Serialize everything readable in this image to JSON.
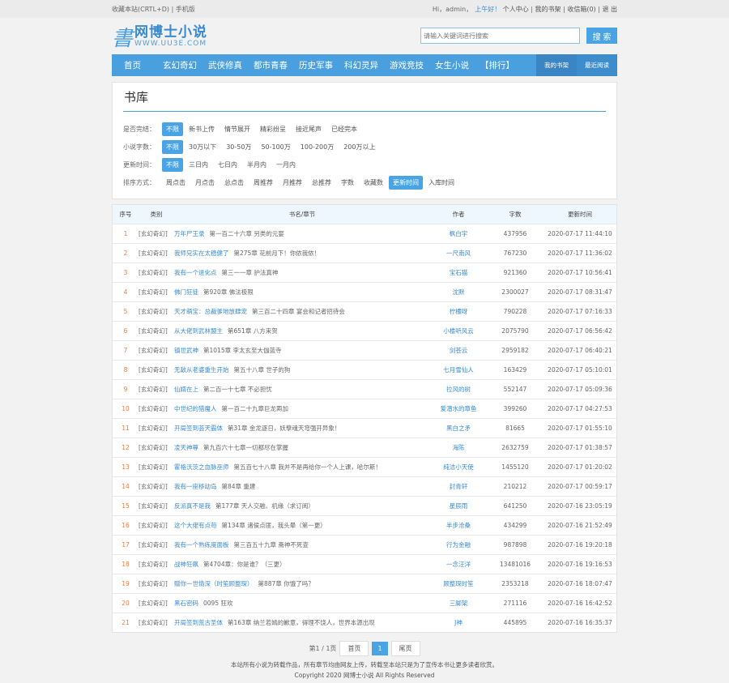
{
  "topbar": {
    "bookmark": "收藏本站(CRTL+D)",
    "sep": "|",
    "mobile": "手机版",
    "greeting": "Hi，admin，",
    "time_greet": "上午好！",
    "user_center": "个人中心",
    "bookshelf": "我的书架",
    "inbox": "收信箱(0)",
    "logout": "退 出"
  },
  "header": {
    "logo_mark": "書",
    "logo_title": "网博士小说",
    "logo_url": "WWW.UU3E.COM",
    "search_placeholder": "请输入关键词进行搜索",
    "search_button": "搜 索"
  },
  "nav": {
    "items": [
      "首页",
      "玄幻奇幻",
      "武侠修真",
      "都市青春",
      "历史军事",
      "科幻灵异",
      "游戏竞技",
      "女生小说",
      "【排行】"
    ],
    "right": [
      "我的书架",
      "最近阅读"
    ]
  },
  "library": {
    "title": "书库",
    "filters": [
      {
        "label": "是否完结：",
        "options": [
          "不限",
          "新书上传",
          "情节展开",
          "精彩纷呈",
          "接近尾声",
          "已经完本"
        ],
        "active": 0
      },
      {
        "label": "小说字数：",
        "options": [
          "不限",
          "30万以下",
          "30-50万",
          "50-100万",
          "100-200万",
          "200万以上"
        ],
        "active": 0
      },
      {
        "label": "更新时间：",
        "options": [
          "不限",
          "三日内",
          "七日内",
          "半月内",
          "一月内"
        ],
        "active": 0
      },
      {
        "label": "排序方式：",
        "options": [
          "周点击",
          "月点击",
          "总点击",
          "周推荐",
          "月推荐",
          "总推荐",
          "字数",
          "收藏数",
          "更新时间",
          "入库时间"
        ],
        "active": 8
      }
    ]
  },
  "table": {
    "headers": [
      "序号",
      "类别",
      "书名/章节",
      "作者",
      "字数",
      "更新时间"
    ],
    "rows": [
      [
        "1",
        "[玄幻奇幻]",
        "万年尸王录",
        "第一百二十六章 另类的元婴",
        "枫白宇",
        "437956",
        "2020-07-17 11:44:10"
      ],
      [
        "2",
        "[玄幻奇幻]",
        "我师兄实在太稳健了",
        "第275章 花前月下！你侬我侬！",
        "一尺南风",
        "767230",
        "2020-07-17 11:36:02"
      ],
      [
        "3",
        "[玄幻奇幻]",
        "我有一个进化点",
        "第三一一章 护法真神",
        "宝石猫",
        "921360",
        "2020-07-17 10:56:41"
      ],
      [
        "4",
        "[玄幻奇幻]",
        "佛门狂徒",
        "第920章 佛法极限",
        "沈默",
        "2300027",
        "2020-07-17 08:31:47"
      ],
      [
        "5",
        "[玄幻奇幻]",
        "天才萌宝：总裁爹地放肆宠",
        "第三百二十四章 宴会和记者招待会",
        "柠檬呀",
        "790228",
        "2020-07-17 07:16:33"
      ],
      [
        "6",
        "[玄幻奇幻]",
        "从大佬到武林盟主",
        "第651章 八方来贺",
        "小楼听风云",
        "2075790",
        "2020-07-17 06:56:42"
      ],
      [
        "7",
        "[玄幻奇幻]",
        "镇世武神",
        "第1015章 李太玄至大伽蓝寺",
        "剑苍云",
        "2959182",
        "2020-07-17 06:40:21"
      ],
      [
        "8",
        "[玄幻奇幻]",
        "无敌从老婆重生开始",
        "第五十八章 世子的狗",
        "七月雪仙人",
        "163429",
        "2020-07-17 05:10:01"
      ],
      [
        "9",
        "[玄幻奇幻]",
        "仙婿在上",
        "第二百一十七章 不必担忧",
        "拉风的树",
        "552147",
        "2020-07-17 05:09:36"
      ],
      [
        "10",
        "[玄幻奇幻]",
        "中世纪的猎魔人",
        "第一百二十九章巨龙兩加",
        "爱潜水的章鱼",
        "399260",
        "2020-07-17 04:27:53"
      ],
      [
        "11",
        "[玄幻奇幻]",
        "开局签到荟天霸体",
        "第31章 金龙逐日，妖孽魂天穹强开异象！",
        "黑白之矛",
        "81665",
        "2020-07-17 01:55:10"
      ],
      [
        "12",
        "[玄幻奇幻]",
        "凌天神尊",
        "第九百六十七章一切都尽在掌握",
        "海陈",
        "2632759",
        "2020-07-17 01:38:57"
      ],
      [
        "13",
        "[玄幻奇幻]",
        "霍格沃茨之血脉巫师",
        "第五百七十八章 我并不是再给你一个人上课，哈尔斯！",
        "纯洁小天使",
        "1455120",
        "2020-07-17 01:20:02"
      ],
      [
        "14",
        "[玄幻奇幻]",
        "我有一座移动岛",
        "第84章 重建",
        "封青轩",
        "210212",
        "2020-07-17 00:59:17"
      ],
      [
        "15",
        "[玄幻奇幻]",
        "反派真不是我",
        "第177章 天人交融、机缘（求订阅）",
        "星辰雨",
        "641250",
        "2020-07-16 23:05:19"
      ],
      [
        "16",
        "[玄幻奇幻]",
        "这个大佬有点苟",
        "第134章 诸侯点匪，我头晕（第一更）",
        "半步沧桑",
        "434299",
        "2020-07-16 21:52:49"
      ],
      [
        "17",
        "[玄幻奇幻]",
        "我有一个熟练度面板",
        "第三百五十九章 斋神不死查",
        "行为金融",
        "987898",
        "2020-07-16 19:20:18"
      ],
      [
        "18",
        "[玄幻奇幻]",
        "战神狂飙",
        "第4704章：你是谁？（三更）",
        "一念汪洋",
        "13481016",
        "2020-07-16 19:16:53"
      ],
      [
        "19",
        "[玄幻奇幻]",
        "赠你一世情深（时笙顾整琛）",
        "第887章 你饿了吗？",
        "顾整琛时笙",
        "2353218",
        "2020-07-16 18:07:47"
      ],
      [
        "20",
        "[玄幻奇幻]",
        "黑石密码",
        "0095 狂欢",
        "三脚架",
        "271116",
        "2020-07-16 16:42:52"
      ],
      [
        "21",
        "[玄幻奇幻]",
        "开局签到荒古圣体",
        "第163章 纳兰若嫣的歉意，得理不饶人，世界本源出现",
        "J神",
        "445895",
        "2020-07-16 16:35:37"
      ]
    ]
  },
  "pager": {
    "info": "第1 / 1页",
    "first": "首页",
    "current": "1",
    "last": "尾页"
  },
  "footer": {
    "notice": "本站所有小说为转载作品，所有章节均由网友上传，转载至本站只是为了宣传本书让更多读者欣赏。",
    "copyright": "Copyright 2020 网博士小说 All Rights Reserved"
  }
}
